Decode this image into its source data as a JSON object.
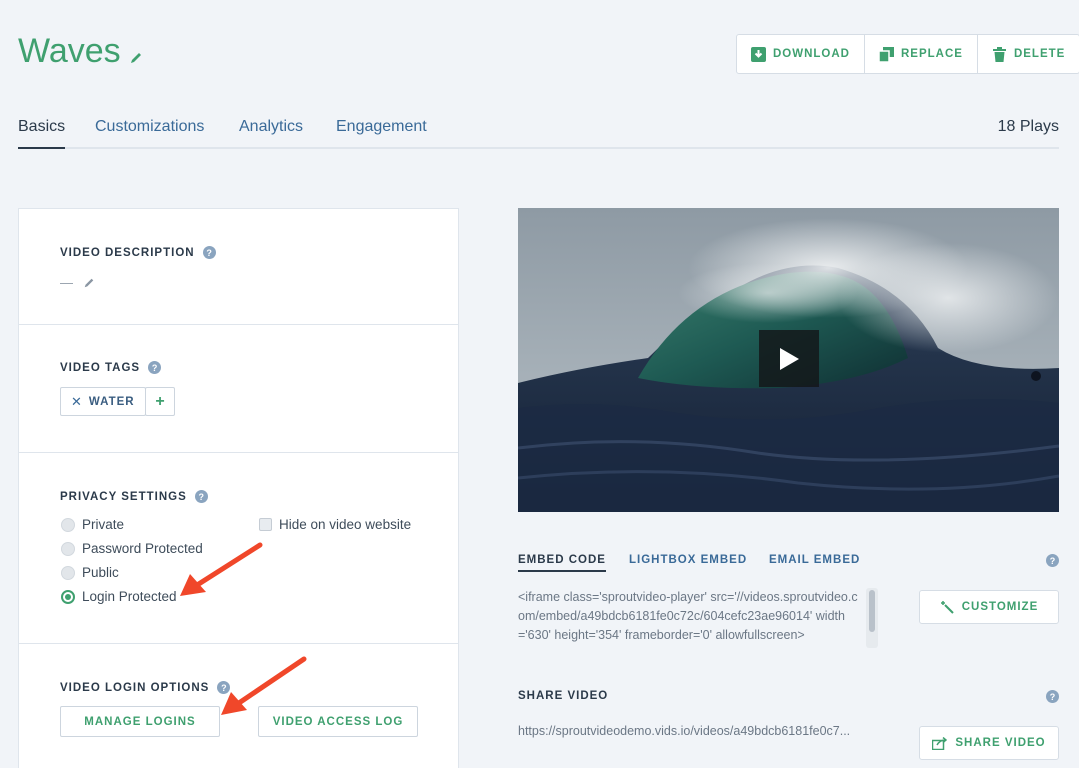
{
  "header": {
    "title": "Waves",
    "actions": {
      "download": "DOWNLOAD",
      "replace": "REPLACE",
      "delete": "DELETE"
    }
  },
  "tabs": [
    "Basics",
    "Customizations",
    "Analytics",
    "Engagement"
  ],
  "plays": "18 Plays",
  "description": {
    "label": "VIDEO DESCRIPTION",
    "value": "—"
  },
  "tags": {
    "label": "VIDEO TAGS",
    "items": [
      "WATER"
    ],
    "add": "+"
  },
  "privacy": {
    "label": "PRIVACY SETTINGS",
    "options": [
      "Private",
      "Password Protected",
      "Public",
      "Login Protected"
    ],
    "selected": "Login Protected",
    "hide_label": "Hide on video website"
  },
  "login_options": {
    "label": "VIDEO LOGIN OPTIONS",
    "manage": "MANAGE LOGINS",
    "access_log": "VIDEO ACCESS LOG"
  },
  "embed": {
    "tabs": [
      "EMBED CODE",
      "LIGHTBOX EMBED",
      "EMAIL EMBED"
    ],
    "code": "<iframe class='sproutvideo-player' src='//videos.sproutvideo.com/embed/a49bdcb6181fe0c72c/604cefc23ae96014' width='630' height='354' frameborder='0' allowfullscreen>",
    "customize": "CUSTOMIZE"
  },
  "share": {
    "label": "SHARE VIDEO",
    "url": "https://sproutvideodemo.vids.io/videos/a49bdcb6181fe0c7...",
    "button": "SHARE VIDEO"
  },
  "colors": {
    "accent": "#3fa06f",
    "link": "#3a6a98",
    "annotation": "#f0472a"
  }
}
